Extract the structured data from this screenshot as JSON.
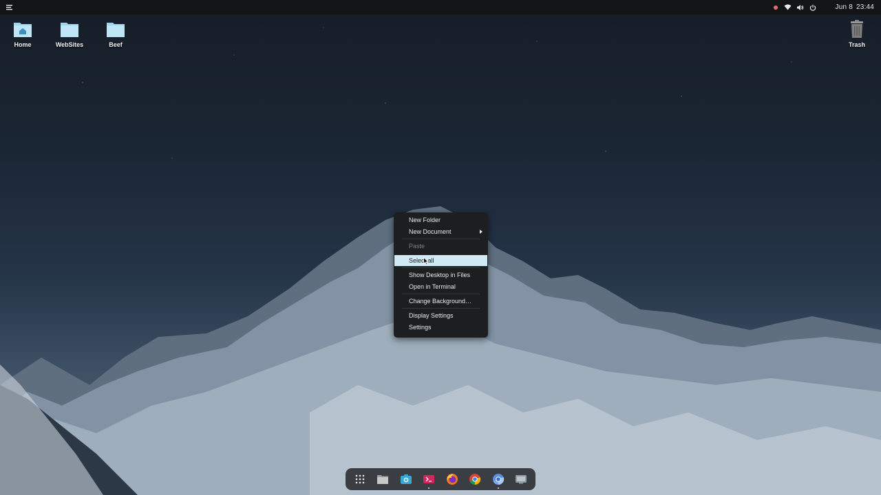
{
  "topbar": {
    "icons": [
      "menu-icon",
      "recording-indicator",
      "wifi-icon",
      "volume-icon",
      "power-icon"
    ],
    "date": "Jun 8",
    "time": "23:44",
    "record_color": "#e06c75"
  },
  "desktop": {
    "icons": [
      {
        "label": "Home",
        "icon": "home-folder-icon"
      },
      {
        "label": "WebSites",
        "icon": "folder-icon"
      },
      {
        "label": "Beef",
        "icon": "folder-icon"
      },
      {
        "label": "Trash",
        "icon": "trash-icon"
      }
    ]
  },
  "context_menu": {
    "items": [
      {
        "label": "New Folder",
        "state": "normal"
      },
      {
        "label": "New Document",
        "state": "submenu"
      },
      {
        "label": "Paste",
        "state": "disabled"
      },
      {
        "label": "Select all",
        "state": "highlighted"
      },
      {
        "label": "Show Desktop in Files",
        "state": "normal"
      },
      {
        "label": "Open in Terminal",
        "state": "normal"
      },
      {
        "label": "Change Background…",
        "state": "normal"
      },
      {
        "label": "Display Settings",
        "state": "normal"
      },
      {
        "label": "Settings",
        "state": "normal"
      }
    ],
    "highlight_color": "#cfe9f5"
  },
  "dock": {
    "items": [
      {
        "name": "app-grid-icon",
        "running": false
      },
      {
        "name": "files-icon",
        "running": false
      },
      {
        "name": "screenshot-icon",
        "running": false
      },
      {
        "name": "app-center-icon",
        "running": true
      },
      {
        "name": "firefox-icon",
        "running": false
      },
      {
        "name": "chrome-icon",
        "running": false
      },
      {
        "name": "chromium-icon",
        "running": true
      },
      {
        "name": "monitor-icon",
        "running": false
      }
    ]
  }
}
